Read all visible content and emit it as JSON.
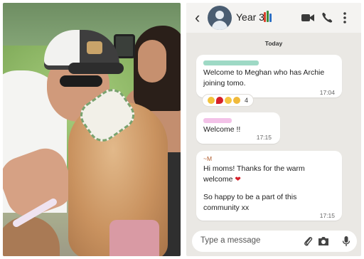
{
  "chat": {
    "title": "Year 3",
    "back_glyph": "‹",
    "icons": {
      "back": "back-arrow-icon",
      "group_avatar": "person-avatar-icon",
      "books_emoji": "books-icon",
      "video_call": "video-camera-icon",
      "voice_call": "phone-icon",
      "menu": "more-vert-icon"
    },
    "day_label": "Today",
    "messages": [
      {
        "sender_bar_color": "#9ed9c5",
        "text": "Welcome to Meghan who has Archie joining tomo.",
        "time": "17:04",
        "reactions": {
          "emojis": [
            "folded-hands",
            "red-heart",
            "waving-hand",
            "thumbs-up"
          ],
          "count": "4"
        }
      },
      {
        "sender_bar_color": "#f3c2e8",
        "text": "Welcome !!",
        "time": "17:15"
      },
      {
        "sender_name": "~M",
        "text_line1": "Hi moms! Thanks for the warm welcome",
        "heart": "❤",
        "text_line2": "So happy to be a part of this community xx",
        "time": "17:15"
      }
    ],
    "input": {
      "placeholder": "Type a message",
      "icons": [
        "paperclip-icon",
        "camera-icon",
        "microphone-icon"
      ]
    }
  },
  "colors": {
    "chat_background": "#eae8e4",
    "bubble": "#ffffff",
    "heart": "#d6202a",
    "sender_name": "#b05a2a"
  }
}
